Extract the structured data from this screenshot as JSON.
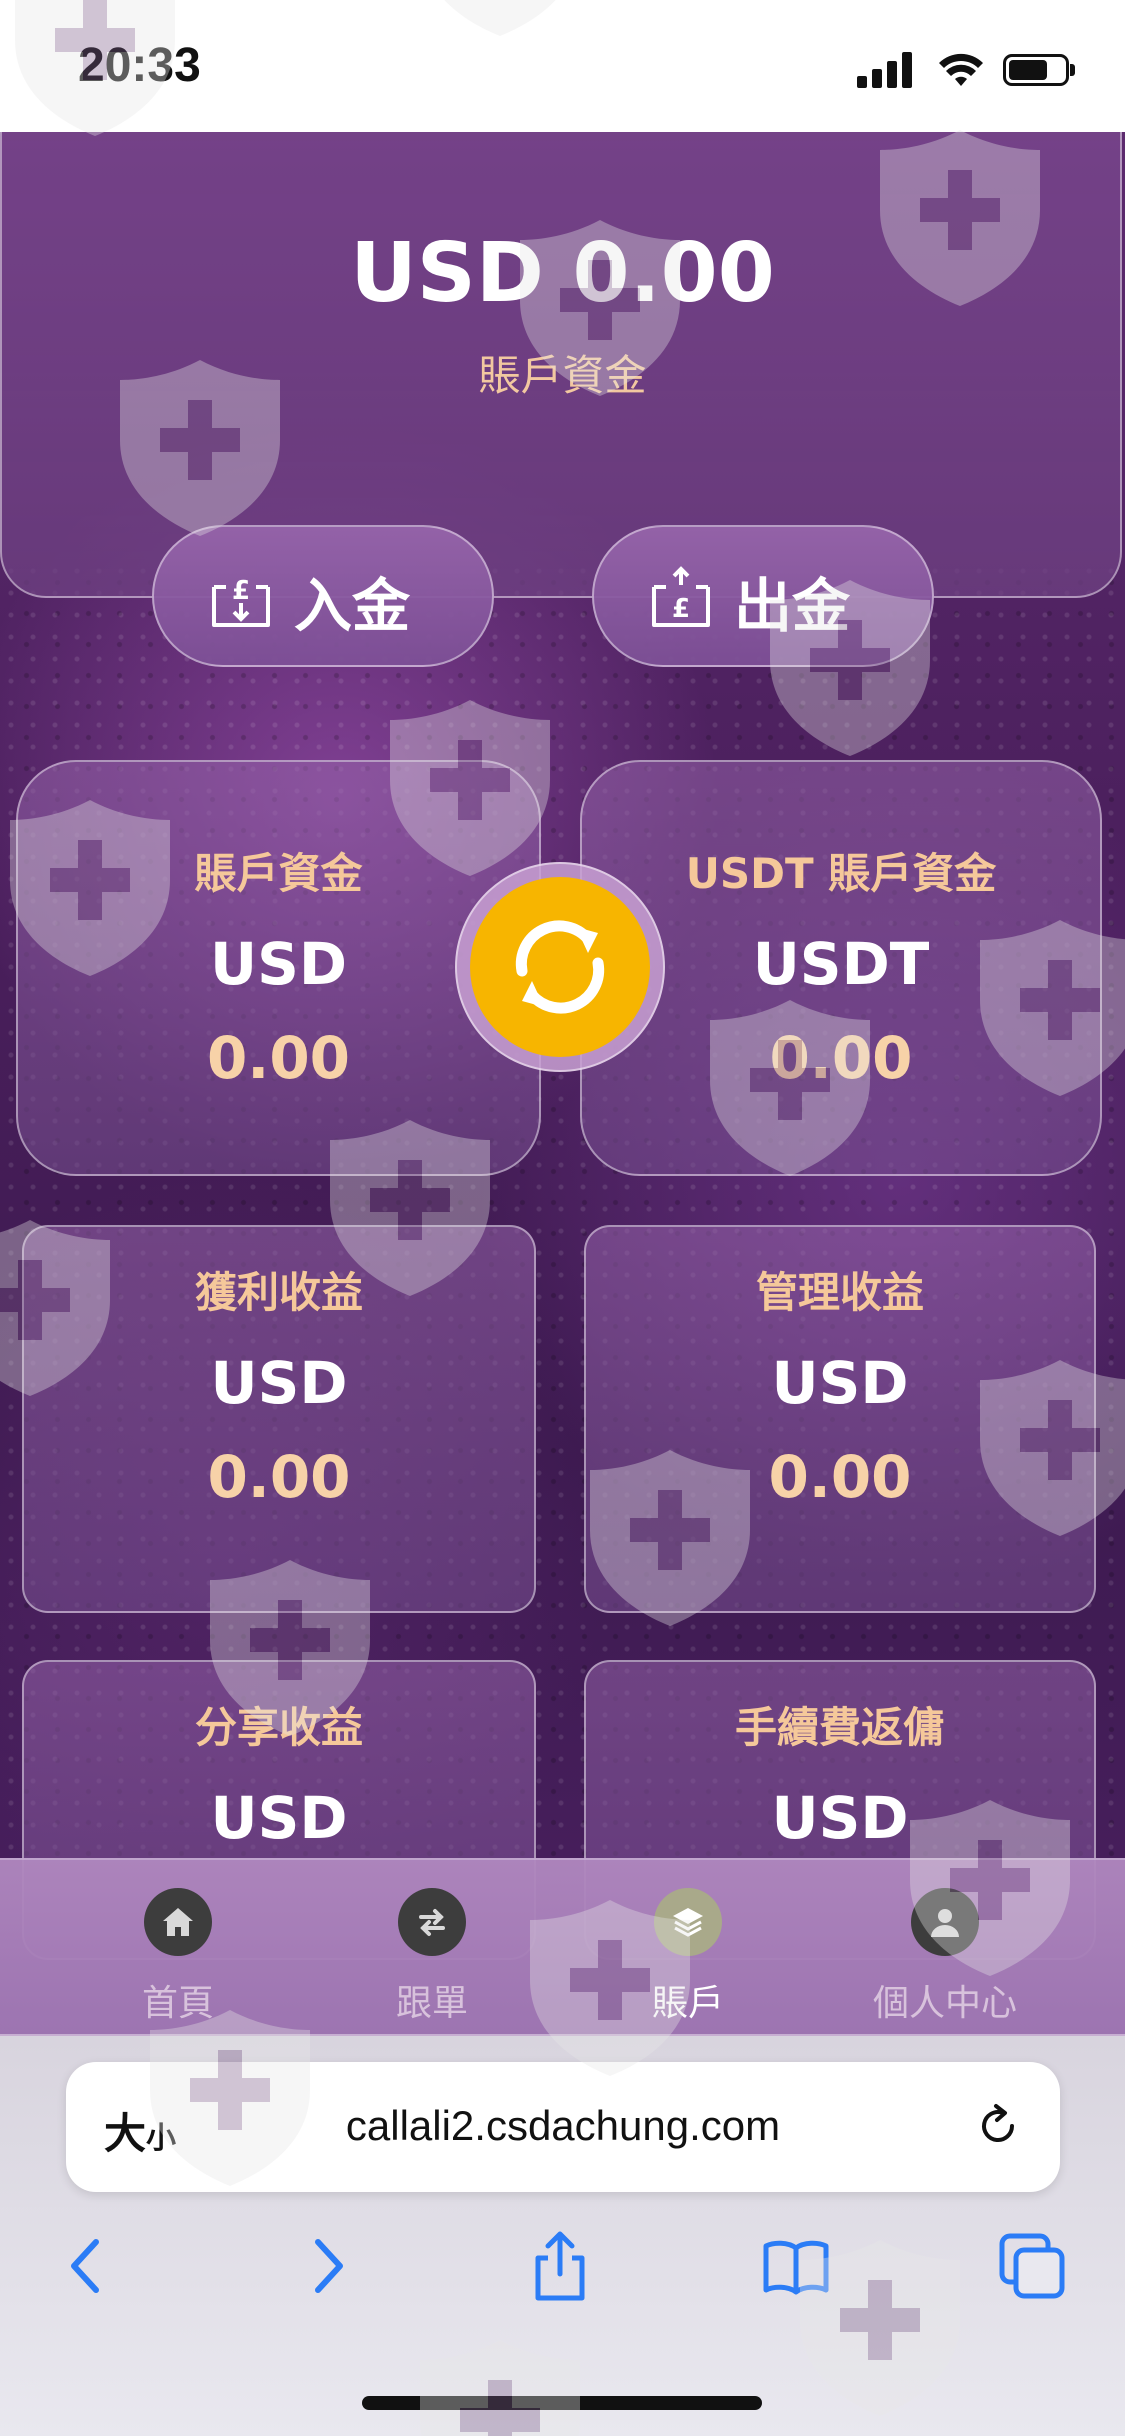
{
  "status_bar": {
    "time": "20:33",
    "battery_level": 0.7
  },
  "balance": {
    "amount": "USD 0.00",
    "label": "賬戶資金"
  },
  "actions": {
    "deposit_label": "入金",
    "withdraw_label": "出金"
  },
  "cards": {
    "account": {
      "title": "賬戶資金",
      "currency": "USD",
      "value": "0.00"
    },
    "usdt": {
      "title": "USDT 賬戶資金",
      "currency": "USDT",
      "value": "0.00"
    },
    "profit": {
      "title": "獲利收益",
      "currency": "USD",
      "value": "0.00"
    },
    "management": {
      "title": "管理收益",
      "currency": "USD",
      "value": "0.00"
    },
    "share": {
      "title": "分享收益",
      "currency": "USD"
    },
    "fee_rebate": {
      "title": "手續費返傭",
      "currency": "USD"
    }
  },
  "tabbar": {
    "items": [
      {
        "label": "首頁",
        "icon": "home-icon",
        "active": false
      },
      {
        "label": "跟單",
        "icon": "swap-icon",
        "active": false
      },
      {
        "label": "賬戶",
        "icon": "layers-icon",
        "active": true
      },
      {
        "label": "個人中心",
        "icon": "user-icon",
        "active": false
      }
    ]
  },
  "browser": {
    "text_size_label": "大",
    "text_size_small": "小",
    "url": "callali2.csdachung.com"
  },
  "colors": {
    "accent_gold": "#f7b500",
    "title_peach": "#f5c89a",
    "ios_blue": "#2b7cf6"
  }
}
